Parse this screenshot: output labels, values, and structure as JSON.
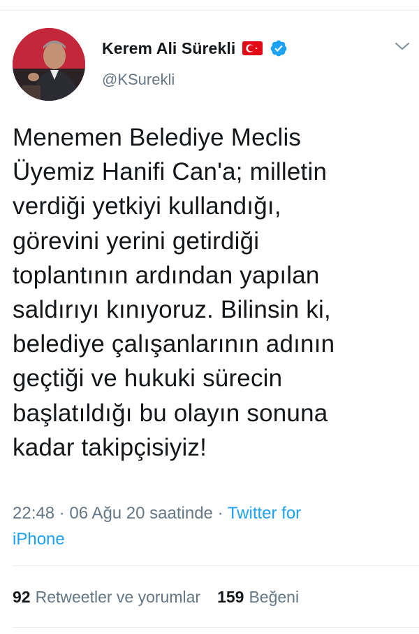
{
  "author": {
    "display_name": "Kerem Ali Sürekli",
    "handle": "@KSurekli"
  },
  "tweet": {
    "lines": [
      "Menemen Belediye Meclis",
      "Üyemiz Hanifi Can'a; milletin",
      "verdiği yetkiyi kullandığı,",
      "görevini yerini getirdiği",
      "toplantının ardından yapılan",
      "saldırıyı kınıyoruz. Bilinsin ki,",
      "belediye çalışanlarının adının",
      "geçtiği ve hukuki sürecin",
      "başlatıldığı bu olayın sonuna",
      "kadar takipçisiyiz!"
    ]
  },
  "meta": {
    "time": "22:48",
    "separator": " · ",
    "date": "06 Ağu 20 saatinde",
    "source_line1": "Twitter for",
    "source_line2": "iPhone"
  },
  "stats": {
    "retweets_count": "92",
    "retweets_label": "Retweetler ve yorumlar",
    "likes_count": "159",
    "likes_label": "Beğeni"
  },
  "icons": {
    "flag": "turkish-flag-icon",
    "verified": "verified-badge-icon",
    "menu": "chevron-down-icon"
  },
  "colors": {
    "accent": "#1da1f2",
    "secondary_text": "#657786",
    "primary_text": "#14171a",
    "flag_red": "#e30a17"
  }
}
